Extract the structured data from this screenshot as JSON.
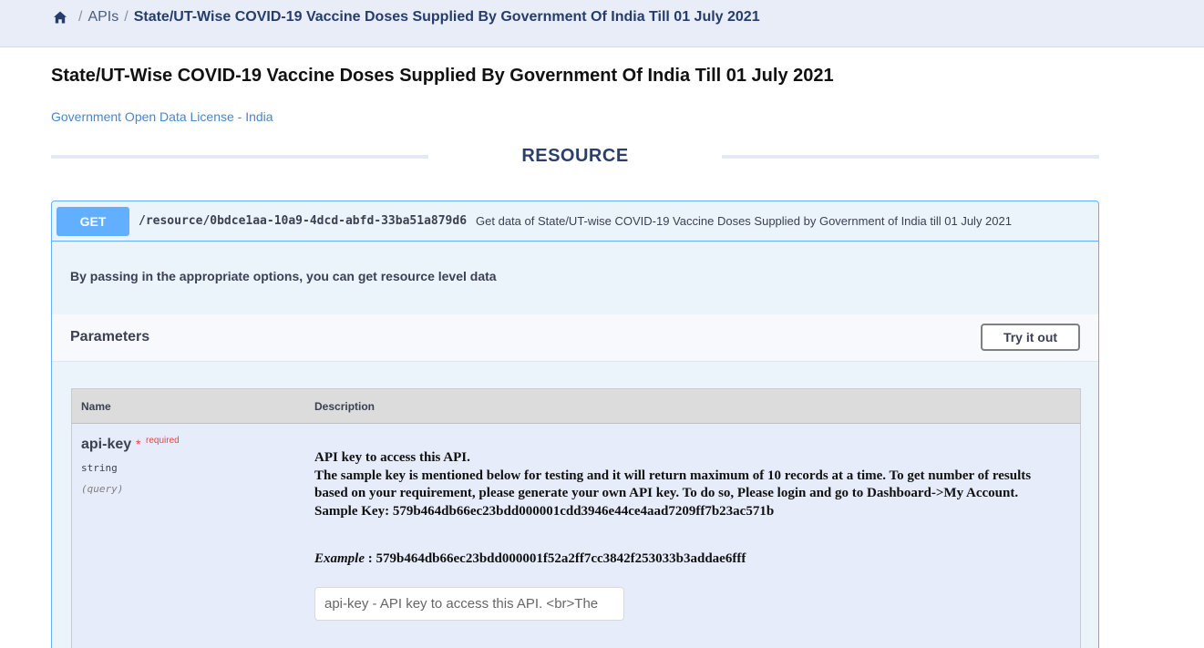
{
  "breadcrumb": {
    "home_icon": "home-icon",
    "separator": "/",
    "apis": "APIs",
    "current": "State/UT-Wise COVID-19 Vaccine Doses Supplied By Government Of India Till 01 July 2021"
  },
  "page": {
    "title": "State/UT-Wise COVID-19 Vaccine Doses Supplied By Government Of India Till 01 July 2021",
    "license": "Government Open Data License - India",
    "section_label": "RESOURCE"
  },
  "operation": {
    "method": "GET",
    "path": "/resource/0bdce1aa-10a9-4dcd-abfd-33ba51a879d6",
    "summary": "Get data of State/UT-wise COVID-19 Vaccine Doses Supplied by Government of India till 01 July 2021",
    "description": "By passing in the appropriate options, you can get resource level data",
    "method_color": "#61affe"
  },
  "parameters": {
    "title": "Parameters",
    "try_button": "Try it out",
    "columns": {
      "name": "Name",
      "description": "Description"
    },
    "items": [
      {
        "name": "api-key",
        "required_star": "*",
        "required_label": "required",
        "type": "string",
        "in": "(query)",
        "desc_line1": "API key to access this API.",
        "desc_line2": "The sample key is mentioned below for testing and it will return maximum of 10 records at a time. To get number of results based on your requirement, please generate your own API key. To do so, Please login and go to Dashboard->My Account.",
        "desc_line3": "Sample Key: 579b464db66ec23bdd000001cdd3946e44ce4aad7209ff7b23ac571b",
        "example_label": "Example",
        "example_value": " : 579b464db66ec23bdd000001f52a2ff7cc3842f253033b3addae6fff",
        "input_placeholder": "api-key - API key to access this API. <br>The"
      }
    ]
  }
}
